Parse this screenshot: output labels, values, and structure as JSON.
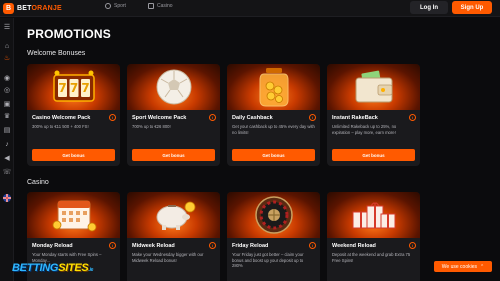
{
  "header": {
    "brand_prefix": "BET",
    "brand_suffix": "ORANJE",
    "nav": [
      {
        "label": "Sport",
        "icon": "whistle-icon"
      },
      {
        "label": "Casino",
        "icon": "cards-icon"
      }
    ],
    "login_label": "Log In",
    "signup_label": "Sign Up"
  },
  "sidebar": {
    "icons": [
      "home-icon",
      "fire-icon",
      "live-icon",
      "basketball-icon",
      "gift-icon",
      "trophy-icon",
      "document-icon",
      "bell-icon",
      "megaphone-icon",
      "support-icon",
      "language-flag-icon"
    ]
  },
  "page": {
    "title": "PROMOTIONS"
  },
  "sections": [
    {
      "title": "Welcome Bonuses",
      "cards": [
        {
          "title": "Casino Welcome Pack",
          "desc": "300% up to €11 500 + 400 FS!",
          "button": "Get bonus",
          "illustration": "slot-777-icon"
        },
        {
          "title": "Sport Welcome Pack",
          "desc": "700% up to €26 800!",
          "button": "Get bonus",
          "illustration": "soccer-ball-icon"
        },
        {
          "title": "Daily Cashback",
          "desc": "Get your cashback up to 45% every day with no limits!",
          "button": "Get bonus",
          "illustration": "coin-jar-icon"
        },
        {
          "title": "Instant RakeBack",
          "desc": "Unlimited Rakeback up to 25%, no expiration – play more, earn more!",
          "button": "Get bonus",
          "illustration": "wallet-icon"
        }
      ]
    },
    {
      "title": "Casino",
      "cards": [
        {
          "title": "Monday Reload",
          "desc": "Your Monday starts with Free Spins – Monday...",
          "illustration": "calendar-icon"
        },
        {
          "title": "Midweek Reload",
          "desc": "Make your Wednesday bigger with our Midweek Reload bonus!",
          "illustration": "piggy-bank-icon"
        },
        {
          "title": "Friday Reload",
          "desc": "Your Friday just got better – claim your bonus and boost up your deposit up to 280%",
          "illustration": "roulette-icon"
        },
        {
          "title": "Weekend Reload",
          "desc": "Deposit at the weekend and grab Extra 75 Free Spins!",
          "illustration": "gift-boxes-icon"
        }
      ]
    }
  ],
  "cookie": {
    "label": "We use cookies"
  },
  "watermark": {
    "part1": "BETTING",
    "part2": "SITES",
    "part3": ".ie"
  },
  "colors": {
    "accent": "#ff5a00",
    "background": "#0b0b0d",
    "card": "#1a1a1d"
  }
}
